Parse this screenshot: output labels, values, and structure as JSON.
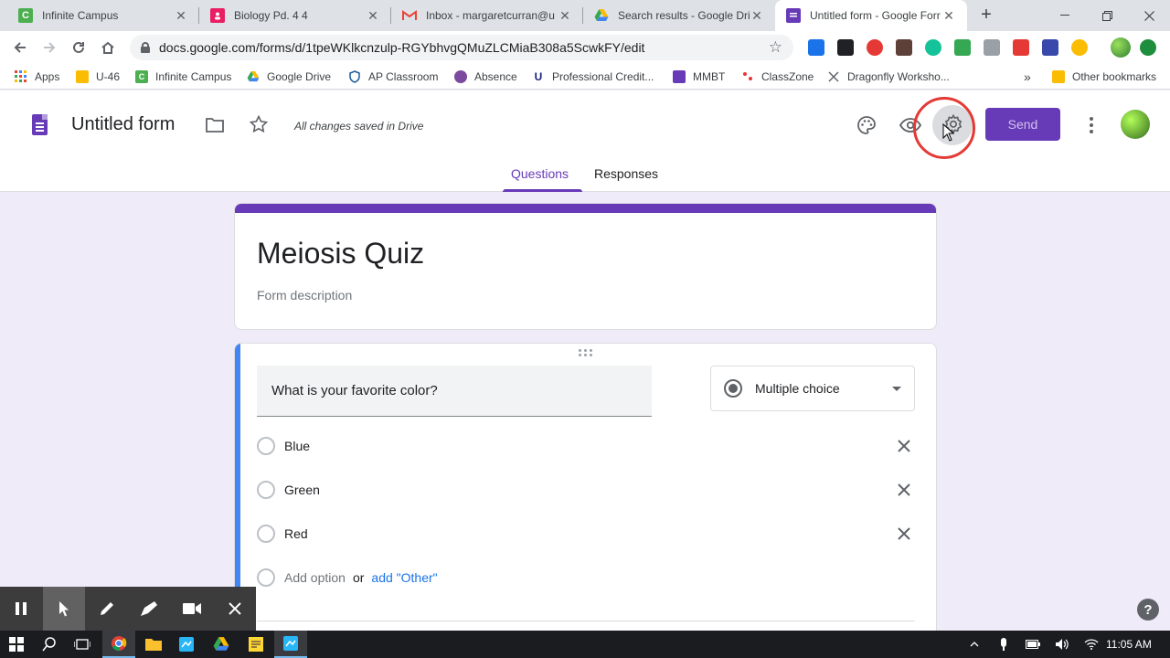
{
  "browser": {
    "tabs": [
      {
        "title": "Infinite Campus",
        "favicon": "campus-icon",
        "color": "#4caf50",
        "letter": "C"
      },
      {
        "title": "Biology Pd. 4 4",
        "favicon": "classroom-icon",
        "color": "#e91e63",
        "letter": ""
      },
      {
        "title": "Inbox - margaretcurran@u",
        "favicon": "gmail-icon",
        "color": "#ea4335",
        "letter": "M"
      },
      {
        "title": "Search results - Google Driv",
        "favicon": "drive-icon",
        "color": "#fbbc04",
        "letter": ""
      },
      {
        "title": "Untitled form - Google Forr",
        "favicon": "forms-icon",
        "color": "#673ab7",
        "letter": ""
      }
    ],
    "url": "docs.google.com/forms/d/1tpeWKlkcnzulp-RGYbhvgQMuZLCMiaB308a5ScwkFY/edit"
  },
  "bookmarks": [
    {
      "label": "Apps",
      "icon": "apps-grid-icon"
    },
    {
      "label": "U-46",
      "icon": "folder-icon"
    },
    {
      "label": "Infinite Campus",
      "icon": "campus-icon"
    },
    {
      "label": "Google Drive",
      "icon": "drive-icon"
    },
    {
      "label": "AP Classroom",
      "icon": "ap-icon"
    },
    {
      "label": "Absence",
      "icon": "absence-icon"
    },
    {
      "label": "Professional Credit...",
      "icon": "university-icon"
    },
    {
      "label": "MMBT",
      "icon": "forms-icon"
    },
    {
      "label": "ClassZone",
      "icon": "classzone-icon"
    },
    {
      "label": "Dragonfly Worksho...",
      "icon": "dragonfly-icon"
    }
  ],
  "bookmarks_overflow": "»",
  "other_bookmarks": "Other bookmarks",
  "forms_header": {
    "title": "Untitled form",
    "saved_status": "All changes saved in Drive",
    "send_label": "Send"
  },
  "form_tabs": {
    "questions": "Questions",
    "responses": "Responses"
  },
  "form": {
    "title": "Meiosis Quiz",
    "description_placeholder": "Form description",
    "question": {
      "text": "What is your favorite color?",
      "type": "Multiple choice",
      "options": [
        "Blue",
        "Green",
        "Red"
      ],
      "add_option": "Add option",
      "or": "or",
      "add_other": "add \"Other\""
    }
  },
  "help_glyph": "?",
  "taskbar": {
    "clock": "11:05 AM"
  },
  "colors": {
    "forms_purple": "#673ab7",
    "question_accent": "#4285f4",
    "highlight_red": "#e53935",
    "page_background": "#f0ebf8"
  }
}
